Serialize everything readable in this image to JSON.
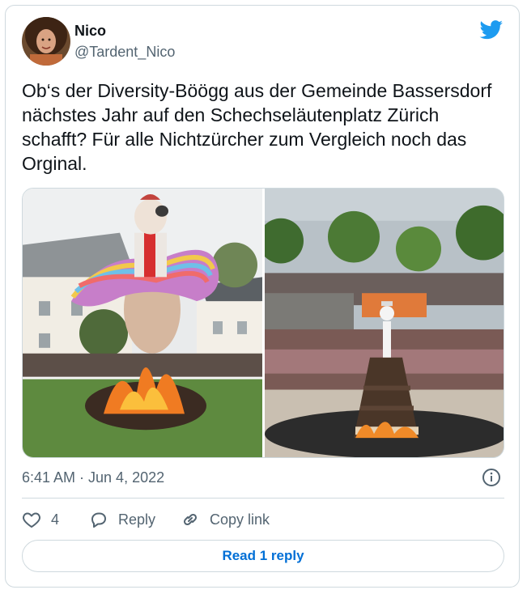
{
  "tweet": {
    "author_name": "Nico",
    "author_handle": "@Tardent_Nico",
    "text": "Ob‘s der Diversity-Böögg aus der Gemeinde Bassersdorf nächstes Jahr auf den Schechseläutenplatz Zürich schafft? Für alle Nichtzürcher zum Vergleich noch das Orginal.",
    "timestamp": "6:41 AM · Jun 4, 2022",
    "like_count": "4",
    "reply_label": "Reply",
    "copy_link_label": "Copy link",
    "read_replies_label": "Read 1 reply"
  },
  "icons": {
    "brand": "twitter-bird-icon",
    "info": "info-icon",
    "like": "heart-icon",
    "reply": "speech-bubble-icon",
    "copy": "link-icon"
  },
  "colors": {
    "brand_blue": "#1d9bf0",
    "link_blue": "#006fd6",
    "muted_text": "#536471",
    "border": "#cfd9de"
  }
}
